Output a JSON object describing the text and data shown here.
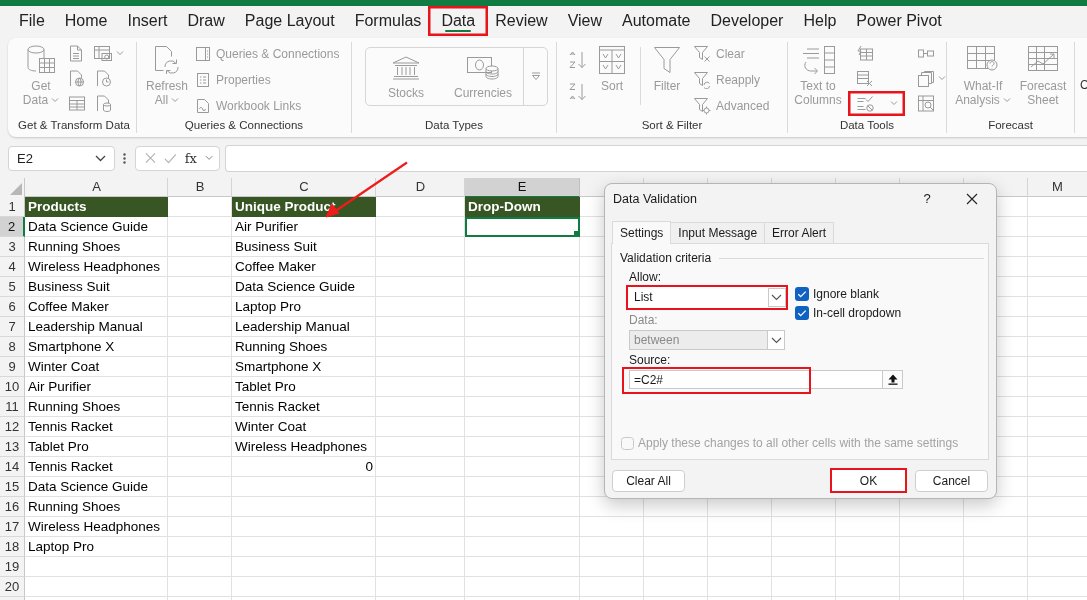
{
  "ribbon_tabs": [
    {
      "label": "File",
      "selected": false,
      "highlighted": false
    },
    {
      "label": "Home",
      "selected": false,
      "highlighted": false
    },
    {
      "label": "Insert",
      "selected": false,
      "highlighted": false
    },
    {
      "label": "Draw",
      "selected": false,
      "highlighted": false
    },
    {
      "label": "Page Layout",
      "selected": false,
      "highlighted": false
    },
    {
      "label": "Formulas",
      "selected": false,
      "highlighted": false
    },
    {
      "label": "Data",
      "selected": true,
      "highlighted": true
    },
    {
      "label": "Review",
      "selected": false,
      "highlighted": false
    },
    {
      "label": "View",
      "selected": false,
      "highlighted": false
    },
    {
      "label": "Automate",
      "selected": false,
      "highlighted": false
    },
    {
      "label": "Developer",
      "selected": false,
      "highlighted": false
    },
    {
      "label": "Help",
      "selected": false,
      "highlighted": false
    },
    {
      "label": "Power Pivot",
      "selected": false,
      "highlighted": false
    }
  ],
  "ribbon": {
    "disabled": true,
    "groups": [
      {
        "kind": "get_transform",
        "label": "Get & Transform Data",
        "button": {
          "lines": [
            "Get",
            "Data"
          ],
          "caret": true
        }
      },
      {
        "kind": "queries",
        "label": "Queries & Connections",
        "button": {
          "lines": [
            "Refresh",
            "All"
          ],
          "caret": true
        },
        "items": [
          "Queries & Connections",
          "Properties",
          "Workbook Links"
        ]
      },
      {
        "kind": "data_types",
        "label": "Data Types",
        "items": [
          "Stocks",
          "Currencies"
        ]
      },
      {
        "kind": "sort_filter",
        "label": "Sort & Filter",
        "buttons": [
          "Sort",
          "Filter"
        ],
        "items": [
          "Clear",
          "Reapply",
          "Advanced"
        ]
      },
      {
        "kind": "data_tools",
        "label": "Data Tools",
        "button": {
          "lines": [
            "Text to",
            "Columns"
          ],
          "caret": false
        },
        "validation_highlighted": true
      },
      {
        "kind": "forecast",
        "label": "Forecast",
        "buttons": [
          {
            "lines": [
              "What-If",
              "Analysis"
            ],
            "caret": true
          },
          {
            "lines": [
              "Forecast",
              "Sheet"
            ],
            "caret": false
          }
        ]
      }
    ],
    "cut_label": "C"
  },
  "formula_bar": {
    "name_box": "E2",
    "fx_label": "fx"
  },
  "sheet": {
    "columns": [
      {
        "label": "A",
        "selected": false
      },
      {
        "label": "B",
        "selected": false
      },
      {
        "label": "C",
        "selected": false
      },
      {
        "label": "D",
        "selected": false
      },
      {
        "label": "E",
        "selected": true
      },
      {
        "label": "M",
        "selected": false
      }
    ],
    "rows": [
      {
        "label": "1",
        "selected": false,
        "cells": {
          "A": {
            "text": "Products",
            "kind": "header",
            "selected": false
          },
          "C": {
            "text": "Unique Product",
            "kind": "header",
            "selected": false
          },
          "E": {
            "text": "Drop-Down",
            "kind": "header",
            "selected": false
          }
        }
      },
      {
        "label": "2",
        "selected": true,
        "cells": {
          "A": {
            "text": "Data Science Guide",
            "kind": "text",
            "selected": false
          },
          "C": {
            "text": "Air Purifier",
            "kind": "text",
            "selected": false
          },
          "E": {
            "kind": "text",
            "selected": true
          }
        }
      },
      {
        "label": "3",
        "selected": false,
        "cells": {
          "A": {
            "text": "Running Shoes",
            "kind": "text",
            "selected": false
          },
          "C": {
            "text": "Business Suit",
            "kind": "text",
            "selected": false
          }
        }
      },
      {
        "label": "4",
        "selected": false,
        "cells": {
          "A": {
            "text": "Wireless Headphones",
            "kind": "text",
            "selected": false
          },
          "C": {
            "text": "Coffee Maker",
            "kind": "text",
            "selected": false
          }
        }
      },
      {
        "label": "5",
        "selected": false,
        "cells": {
          "A": {
            "text": "Business Suit",
            "kind": "text",
            "selected": false
          },
          "C": {
            "text": "Data Science Guide",
            "kind": "text",
            "selected": false
          }
        }
      },
      {
        "label": "6",
        "selected": false,
        "cells": {
          "A": {
            "text": "Coffee Maker",
            "kind": "text",
            "selected": false
          },
          "C": {
            "text": "Laptop Pro",
            "kind": "text",
            "selected": false
          }
        }
      },
      {
        "label": "7",
        "selected": false,
        "cells": {
          "A": {
            "text": "Leadership Manual",
            "kind": "text",
            "selected": false
          },
          "C": {
            "text": "Leadership Manual",
            "kind": "text",
            "selected": false
          }
        }
      },
      {
        "label": "8",
        "selected": false,
        "cells": {
          "A": {
            "text": "Smartphone X",
            "kind": "text",
            "selected": false
          },
          "C": {
            "text": "Running Shoes",
            "kind": "text",
            "selected": false
          }
        }
      },
      {
        "label": "9",
        "selected": false,
        "cells": {
          "A": {
            "text": "Winter Coat",
            "kind": "text",
            "selected": false
          },
          "C": {
            "text": "Smartphone X",
            "kind": "text",
            "selected": false
          }
        }
      },
      {
        "label": "10",
        "selected": false,
        "cells": {
          "A": {
            "text": "Air Purifier",
            "kind": "text",
            "selected": false
          },
          "C": {
            "text": "Tablet Pro",
            "kind": "text",
            "selected": false
          }
        }
      },
      {
        "label": "11",
        "selected": false,
        "cells": {
          "A": {
            "text": "Running Shoes",
            "kind": "text",
            "selected": false
          },
          "C": {
            "text": "Tennis Racket",
            "kind": "text",
            "selected": false
          }
        }
      },
      {
        "label": "12",
        "selected": false,
        "cells": {
          "A": {
            "text": "Tennis Racket",
            "kind": "text",
            "selected": false
          },
          "C": {
            "text": "Winter Coat",
            "kind": "text",
            "selected": false
          }
        }
      },
      {
        "label": "13",
        "selected": false,
        "cells": {
          "A": {
            "text": "Tablet Pro",
            "kind": "text",
            "selected": false
          },
          "C": {
            "text": "Wireless Headphones",
            "kind": "text",
            "selected": false
          }
        }
      },
      {
        "label": "14",
        "selected": false,
        "cells": {
          "A": {
            "text": "Tennis Racket",
            "kind": "text",
            "selected": false
          },
          "C": {
            "text": "0",
            "kind": "number",
            "selected": false
          }
        }
      },
      {
        "label": "15",
        "selected": false,
        "cells": {
          "A": {
            "text": "Data Science Guide",
            "kind": "text",
            "selected": false
          }
        }
      },
      {
        "label": "16",
        "selected": false,
        "cells": {
          "A": {
            "text": "Running Shoes",
            "kind": "text",
            "selected": false
          }
        }
      },
      {
        "label": "17",
        "selected": false,
        "cells": {
          "A": {
            "text": "Wireless Headphones",
            "kind": "text",
            "selected": false
          }
        }
      },
      {
        "label": "18",
        "selected": false,
        "cells": {
          "A": {
            "text": "Laptop Pro",
            "kind": "text",
            "selected": false
          }
        }
      },
      {
        "label": "19",
        "selected": false
      },
      {
        "label": "20",
        "selected": false
      }
    ]
  },
  "dialog": {
    "title": "Data Validation",
    "help_label": "?",
    "tabs": [
      {
        "label": "Settings",
        "selected": true
      },
      {
        "label": "Input Message",
        "selected": false
      },
      {
        "label": "Error Alert",
        "selected": false
      }
    ],
    "section": "Validation criteria",
    "dropdowns": [
      {
        "label": "Allow:",
        "value": "List",
        "disabled": false,
        "highlighted": true
      },
      {
        "label": "Data:",
        "value": "between",
        "disabled": true,
        "highlighted": false
      }
    ],
    "checkboxes": [
      {
        "label": "Ignore blank",
        "checked": true,
        "disabled": false
      },
      {
        "label": "In-cell dropdown",
        "checked": true,
        "disabled": false
      }
    ],
    "source": {
      "label": "Source:",
      "value": "=C2#",
      "highlighted": true
    },
    "apply": {
      "label": "Apply these changes to all other cells with the same settings",
      "checked": false,
      "disabled": true
    },
    "buttons": [
      {
        "label": "Clear All",
        "kind": "reset",
        "highlighted": false
      },
      {
        "label": "OK",
        "kind": "confirm",
        "highlighted": true
      },
      {
        "label": "Cancel",
        "kind": "cancel",
        "highlighted": false
      }
    ]
  }
}
